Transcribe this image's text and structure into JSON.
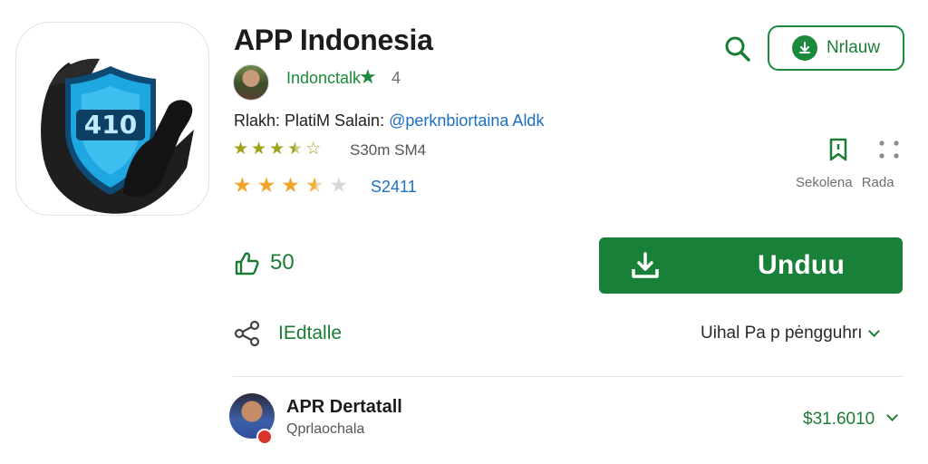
{
  "app": {
    "title": "APP Indonesia",
    "icon_text": "410"
  },
  "header": {
    "search_icon": "search-icon",
    "install_label": "Nrlauw"
  },
  "developer": {
    "name": "Indonctalk",
    "star": "★",
    "count": "4"
  },
  "meta": {
    "prefix": "Rlakh: PlatiM Salain: ",
    "link": "@perknbiortaina Aldk"
  },
  "rating": {
    "stars_row1": 3.5,
    "size_text": "S30m SM4",
    "stars_row2": 3.5,
    "count": "S2411"
  },
  "side": {
    "labels": "Sekolena Rada"
  },
  "likes": {
    "count": "50"
  },
  "download": {
    "label": "Unduu"
  },
  "details": {
    "label": "IEdtalle",
    "view_label": "Uihal Pa p pėngguhrı"
  },
  "row": {
    "title": "APR Dertatall",
    "subtitle": "Qprlaochala",
    "value": "$31.6010"
  },
  "colors": {
    "accent_green": "#188038",
    "link_blue": "#1d6fc2",
    "shield_blue": "#1ea7e0"
  }
}
